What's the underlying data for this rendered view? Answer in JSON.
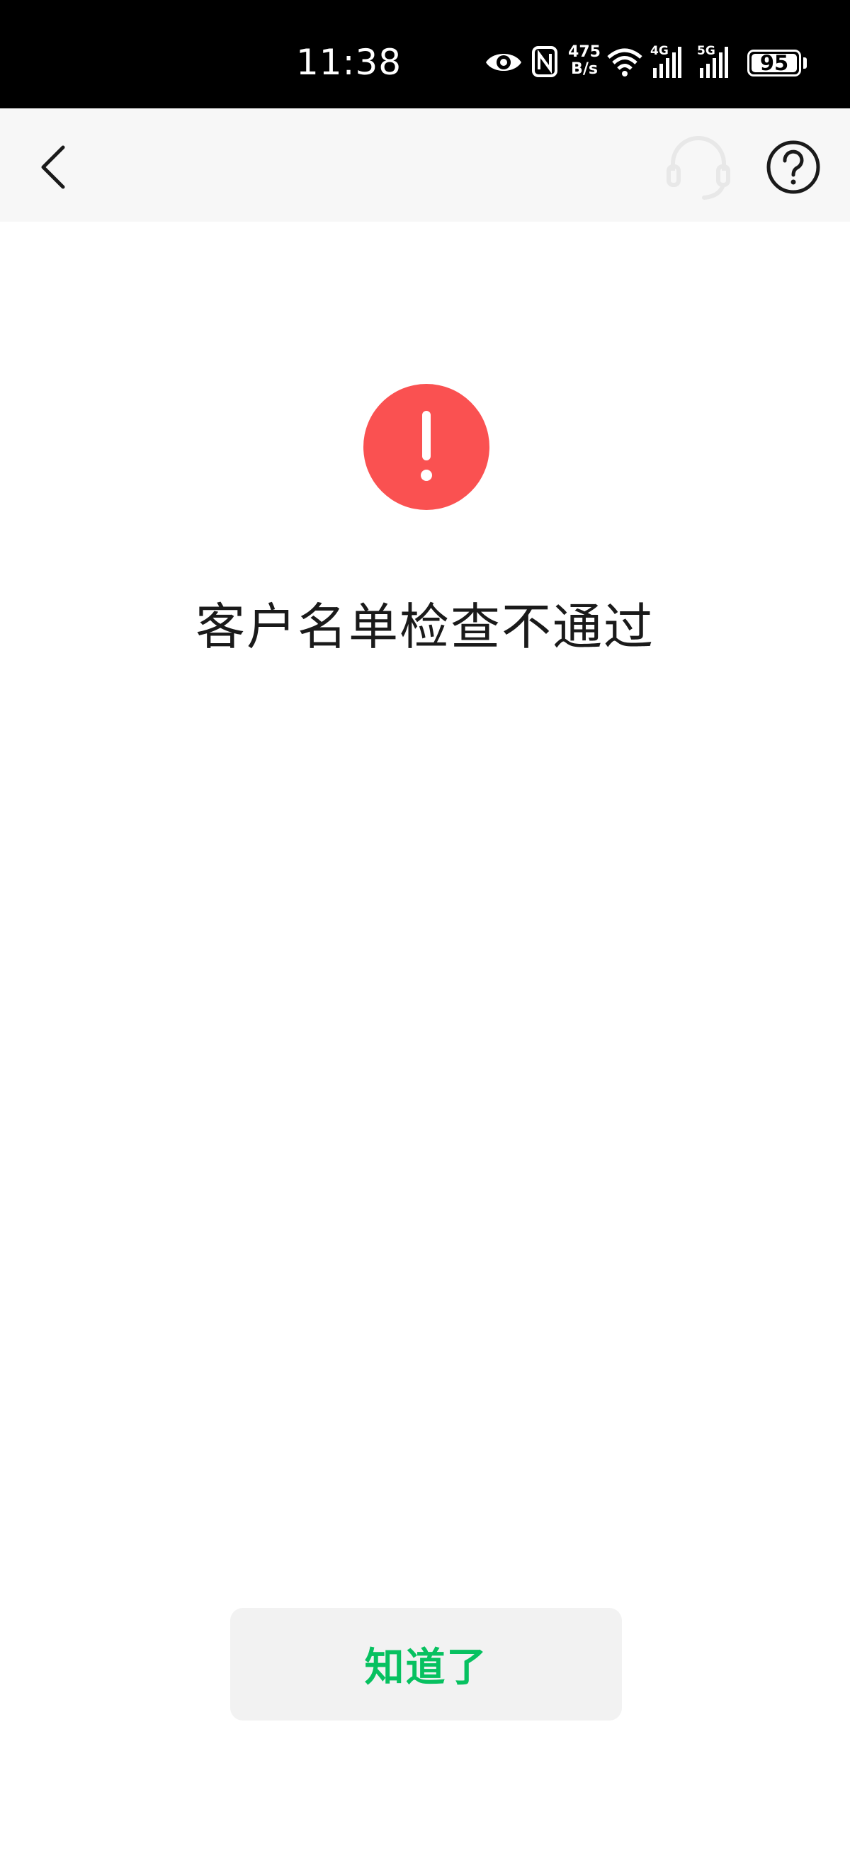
{
  "status_bar": {
    "time": "11:38",
    "net_speed_value": "475",
    "net_speed_unit": "B/s",
    "network_4g": "4G",
    "network_5g": "5G",
    "battery_level": "95",
    "icons": [
      "eye-icon",
      "nfc-icon",
      "wifi-icon",
      "signal-4g-icon",
      "signal-5g-icon",
      "battery-icon"
    ]
  },
  "nav": {
    "back_icon": "chevron-left-icon",
    "support_icon": "headset-icon",
    "help_icon": "question-circle-icon"
  },
  "result": {
    "icon": "exclamation-circle-icon",
    "icon_color": "#fa5151",
    "title": "客户名单检查不通过"
  },
  "actions": {
    "confirm_label": "知道了",
    "accent_color": "#07c160"
  }
}
